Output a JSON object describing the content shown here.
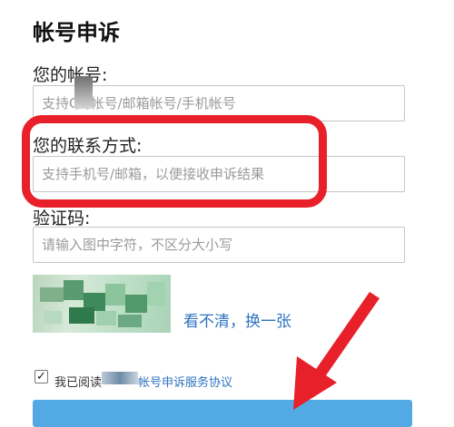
{
  "page": {
    "title": "帐号申诉"
  },
  "form": {
    "account_label": "您的帐号:",
    "account_placeholder": "支持QQ帐号/邮箱帐号/手机帐号",
    "contact_label": "您的联系方式:",
    "contact_placeholder": "支持手机号/邮箱，以便接收申诉结果",
    "captcha_label": "验证码:",
    "captcha_placeholder": "请输入图中字符，不区分大小写",
    "refresh_link": "看不清，换一张"
  },
  "agreement": {
    "checked": true,
    "prefix": "我已阅读",
    "link": "帐号申诉服务协议"
  },
  "colors": {
    "highlight": "#e8202a",
    "link": "#2f73c0",
    "button": "#52a9e3",
    "arrow": "#e8202a"
  }
}
